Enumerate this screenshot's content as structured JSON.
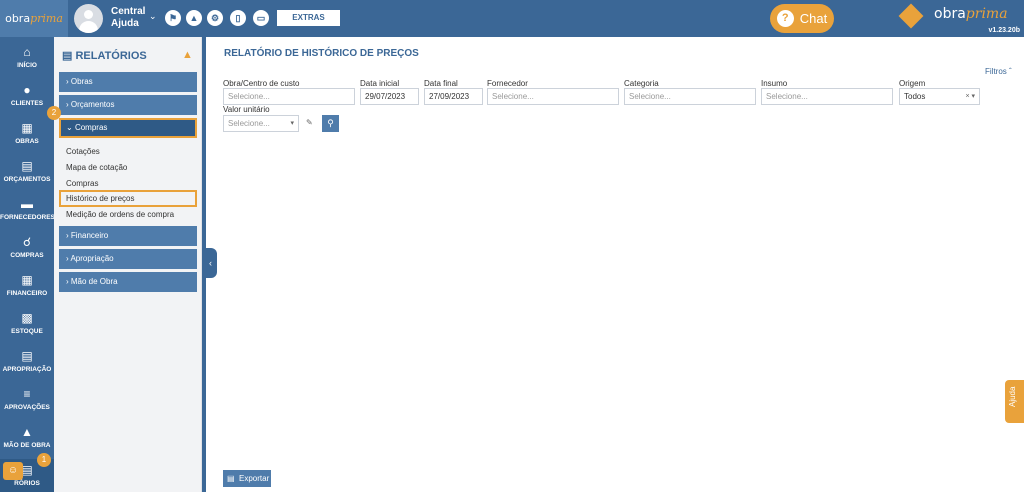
{
  "topbar": {
    "logo": {
      "left": "obra",
      "right": "prima"
    },
    "user_name": "Central Ajuda",
    "extras_label": "EXTRAS",
    "chat_label": "Chat",
    "brand": {
      "left": "obra",
      "right": "prima",
      "version": "v1.23.20b"
    },
    "icons": [
      "flag-icon",
      "graduation-cap-icon",
      "gear-icon",
      "phone-icon",
      "monitor-icon"
    ]
  },
  "nav": [
    {
      "label": "INÍCIO",
      "icon": "home-icon"
    },
    {
      "label": "CLIENTES",
      "icon": "user-icon"
    },
    {
      "label": "OBRAS",
      "icon": "building-icon"
    },
    {
      "label": "ORÇAMENTOS",
      "icon": "document-icon"
    },
    {
      "label": "FORNECEDORES",
      "icon": "truck-icon"
    },
    {
      "label": "COMPRAS",
      "icon": "cart-icon"
    },
    {
      "label": "FINANCEIRO",
      "icon": "calculator-icon"
    },
    {
      "label": "ESTOQUE",
      "icon": "boxes-icon"
    },
    {
      "label": "APROPRIAÇÃO",
      "icon": "file-check-icon"
    },
    {
      "label": "APROVAÇÕES",
      "icon": "list-check-icon"
    },
    {
      "label": "MÃO DE OBRA",
      "icon": "workers-icon"
    },
    {
      "label": "RÓRIOS",
      "icon": "report-icon"
    }
  ],
  "sidebar": {
    "title": "RELATÓRIOS",
    "groups": [
      "Obras",
      "Orçamentos",
      "Compras",
      "Financeiro",
      "Apropriação",
      "Mão de Obra"
    ],
    "compras_links": [
      "Cotações",
      "Mapa de cotação",
      "Compras",
      "Histórico de preços",
      "Medição de ordens de compra"
    ]
  },
  "steps": {
    "one": "1",
    "two": "2"
  },
  "main": {
    "title": "RELATÓRIO DE HISTÓRICO DE PREÇOS",
    "filters_label": "Filtros",
    "fields": {
      "obra": {
        "label": "Obra/Centro de custo",
        "placeholder": "Selecione..."
      },
      "data_inicial": {
        "label": "Data inicial",
        "value": "29/07/2023"
      },
      "data_final": {
        "label": "Data final",
        "value": "27/09/2023"
      },
      "fornecedor": {
        "label": "Fornecedor",
        "placeholder": "Selecione..."
      },
      "categoria": {
        "label": "Categoria",
        "placeholder": "Selecione..."
      },
      "insumo": {
        "label": "Insumo",
        "placeholder": "Selecione..."
      },
      "origem": {
        "label": "Origem",
        "value": "Todos"
      },
      "valor_unitario": {
        "label": "Valor unitário",
        "placeholder": "Selecione..."
      }
    },
    "export_label": "Exportar"
  },
  "help_label": "Ajuda",
  "colors": {
    "primary": "#3b6796",
    "primary_light": "#4f7cab",
    "accent": "#e9a23b"
  }
}
